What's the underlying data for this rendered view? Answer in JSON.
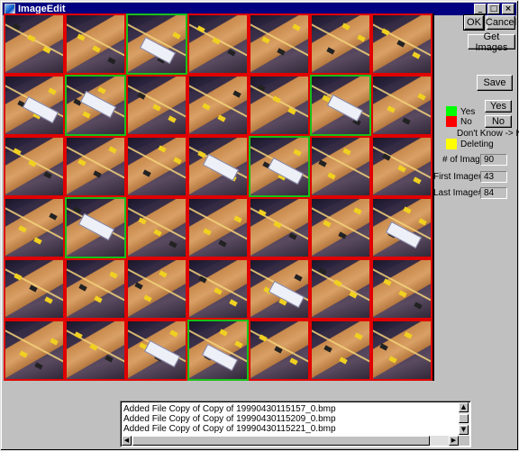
{
  "window": {
    "title": "ImageEdit",
    "controls": [
      "_",
      "□",
      "×"
    ]
  },
  "grid": {
    "columns": 7,
    "rows": 6,
    "colors": {
      "yes": "#18c018",
      "no": "#e00000"
    },
    "cells": [
      "no",
      "no",
      "yes",
      "no",
      "no",
      "no",
      "no",
      "no",
      "yes",
      "no",
      "no",
      "no",
      "yes",
      "no",
      "no",
      "no",
      "no",
      "no",
      "yes",
      "no",
      "no",
      "no",
      "yes",
      "no",
      "no",
      "no",
      "no",
      "no",
      "no",
      "no",
      "no",
      "no",
      "no",
      "no",
      "no",
      "no",
      "no",
      "no",
      "yes",
      "no",
      "no",
      "no"
    ]
  },
  "buttons": {
    "ok": "OK",
    "cancel": "Cancel",
    "get_images": "Get Images",
    "save": "Save",
    "yes": "Yes",
    "no": "No"
  },
  "legend": {
    "yes_label": "Yes",
    "yes_color": "#00ff00",
    "no_label": "No",
    "no_color": "#ff0000",
    "dont_know": "Don't Know -> No",
    "deleting_label": "Deleting",
    "deleting_color": "#ffff00"
  },
  "stats": {
    "num_images_label": "# of Images:",
    "num_images": "90",
    "first_image_label": "First Image#:",
    "first_image": "43",
    "last_image_label": "Last Image#:",
    "last_image": "84"
  },
  "log": {
    "lines": [
      "Added File Copy of Copy of 19990430115157_0.bmp",
      "Added File Copy of Copy of 19990430115209_0.bmp",
      "Added File Copy of Copy of 19990430115221_0.bmp"
    ]
  }
}
